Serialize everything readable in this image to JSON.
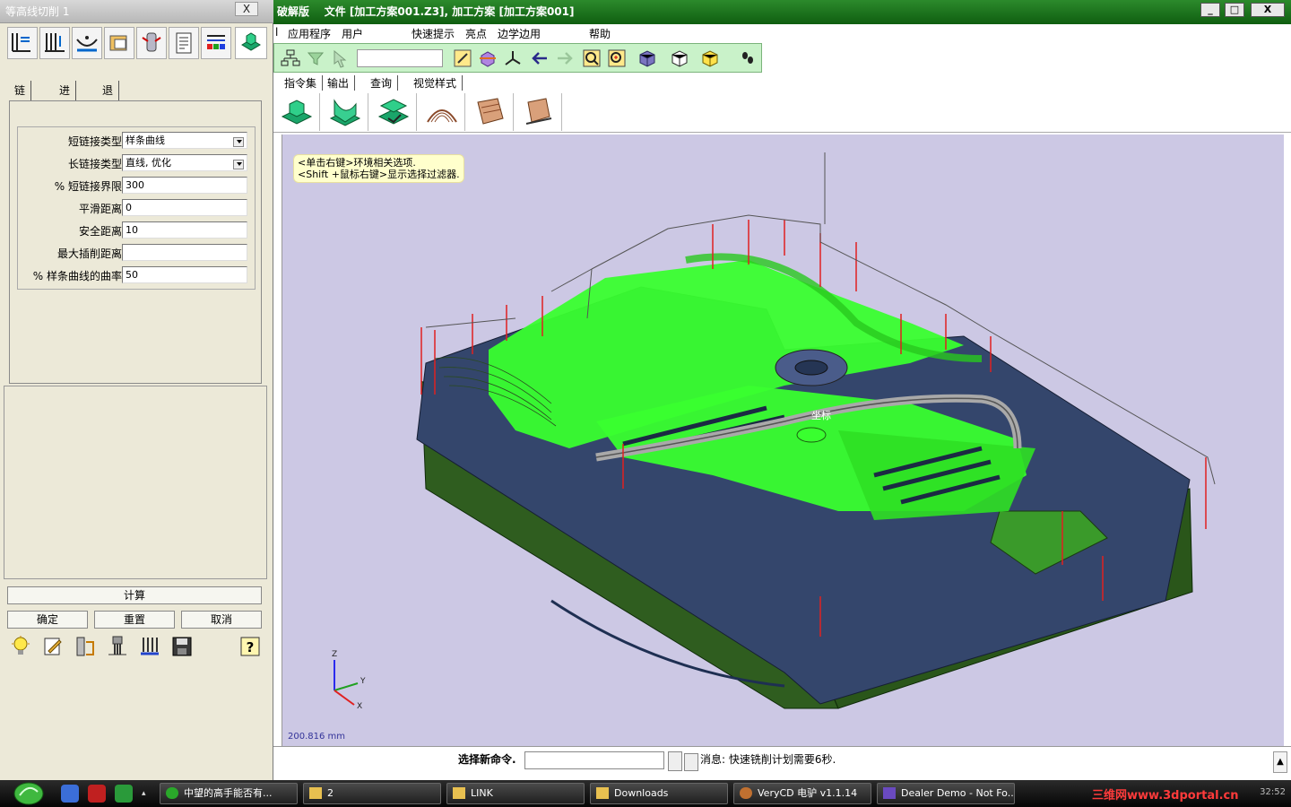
{
  "left_dialog": {
    "title": "等高线切削 1",
    "close_label": "X",
    "tabs": [
      "链接",
      "进刀",
      "退刀"
    ],
    "params": [
      {
        "label": "短链接类型",
        "value": "样条曲线",
        "kind": "select"
      },
      {
        "label": "长链接类型",
        "value": "直线, 优化",
        "kind": "select"
      },
      {
        "label": "% 短链接界限",
        "value": "300",
        "kind": "input"
      },
      {
        "label": "平滑距离",
        "value": "0",
        "kind": "input"
      },
      {
        "label": "安全距离",
        "value": "10",
        "kind": "input"
      },
      {
        "label": "最大插削距离",
        "value": "",
        "kind": "input"
      },
      {
        "label": "% 样条曲线的曲率",
        "value": "50",
        "kind": "input"
      }
    ],
    "compute_label": "计算",
    "ok_label": "确定",
    "reset_label": "重置",
    "cancel_label": "取消"
  },
  "main_window": {
    "title": "破解版    文件 [加工方案001.Z3], 加工方案 [加工方案001]",
    "title_prefix": "破解版",
    "title_rest": "文件 [加工方案001.Z3], 加工方案 [加工方案001]",
    "win_buttons": [
      "_",
      "□",
      "X"
    ]
  },
  "menu": [
    "应用程序",
    "用户",
    "快速提示",
    "亮点",
    "边学边用",
    "帮助"
  ],
  "menu_lead": "l",
  "toolbar_tabs": [
    "指令集",
    "输出",
    "查询",
    "视觉样式"
  ],
  "viewport": {
    "hint_line1": "<单击右键>环境相关选项.",
    "hint_line2": "<Shift +鼠标右键>显示选择过滤器.",
    "scale": "200.816 mm",
    "cursor_label": "坐标",
    "axis_labels": {
      "z": "Z",
      "y": "Y",
      "x": "X"
    },
    "bg_color": "#ccc8e4",
    "part_color_side": "#2f5d1f",
    "part_color_top": "#34466c",
    "toolpath_color": "#39ff2f"
  },
  "command_bar": {
    "label": "选择新命令.",
    "input_value": "",
    "message": "消息: 快速铣削计划需要6秒.",
    "scroll_glyph": "▲"
  },
  "taskbar": {
    "tasks": [
      {
        "label": "中望的高手能否有...",
        "icon": "chat-icon"
      },
      {
        "label": "2",
        "icon": "folder-icon"
      },
      {
        "label": "LINK",
        "icon": "folder-icon"
      },
      {
        "label": "Downloads",
        "icon": "folder-icon"
      },
      {
        "label": "VeryCD 电驴 v1.1.14",
        "icon": "donkey-icon"
      },
      {
        "label": "Dealer Demo - Not Fo...",
        "icon": "app-icon"
      }
    ],
    "watermark": "三维网www.3dportal.cn",
    "clock": "32:52"
  }
}
